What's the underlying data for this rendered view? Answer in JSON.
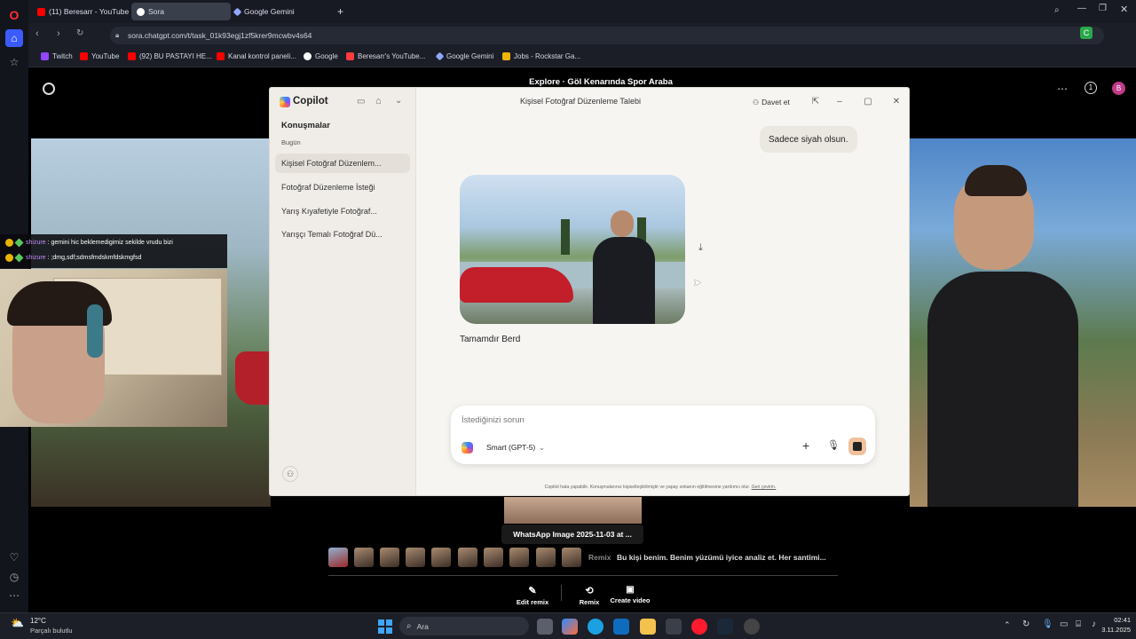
{
  "browser": {
    "tabs": [
      {
        "label": "(11) Beresarr - YouTube",
        "color": "#ff0000"
      },
      {
        "label": "Sora",
        "color": "#ffffff"
      },
      {
        "label": "Google Gemini",
        "color": "#8fa8ff"
      }
    ],
    "url": "sora.chatgpt.com/t/task_01k93egj1zf5krer9mcwbv4s64",
    "bookmarks": [
      {
        "label": "Twitch",
        "color": "#9146ff"
      },
      {
        "label": "YouTube",
        "color": "#ff0000"
      },
      {
        "label": "(92) BU PASTAYI HE...",
        "color": "#ff0000"
      },
      {
        "label": "Kanal kontrol paneli...",
        "color": "#ff0000"
      },
      {
        "label": "Google",
        "color": "#ffffff"
      },
      {
        "label": "Beresarr's YouTube...",
        "color": "#ff3b3b"
      },
      {
        "label": "Google Gemini",
        "color": "#8fa8ff"
      },
      {
        "label": "Jobs - Rockstar Ga...",
        "color": "#f0b400"
      }
    ]
  },
  "sora": {
    "title": "Explore  ·  Göl Kenarında Spor Araba",
    "hover_caption": "WhatsApp Image 2025-11-03 at ...",
    "remix_label": "Remix",
    "prompt_text": "Bu kişi benim. Benim yüzümü iyice analiz et. Her santimi...",
    "actions": [
      {
        "label": "Edit remix"
      },
      {
        "label": "Remix"
      },
      {
        "label": "Create video"
      }
    ],
    "notification_count": "1",
    "avatar_letter": "B"
  },
  "stream_chat": [
    {
      "user": "shizure",
      "text": "gemini hic beklemedigimiz sekilde vrudu bizi"
    },
    {
      "user": "shizure",
      "text": ";dmg,sdf;sdmsfmdskmfdskmgfsd"
    }
  ],
  "copilot": {
    "app_name": "Copilot",
    "section_title": "Konuşmalar",
    "section_sub": "Bugün",
    "conversations": [
      "Kişisel Fotoğraf Düzenlem...",
      "Fotoğraf Düzenleme İsteği",
      "Yarış Kıyafetiyle Fotoğraf...",
      "Yarışçı Temalı Fotoğraf Dü..."
    ],
    "chat_title": "Kişisel Fotoğraf Düzenleme Talebi",
    "invite_label": "Davet et",
    "user_message": "Sadece siyah olsun.",
    "assistant_message": "Tamamdır Berd",
    "composer_placeholder": "İstediğinizi sorun",
    "model_label": "Smart (GPT-5)",
    "disclaimer": "Copilot hata yapabilir. Konuşmalarınız kişiselleştirilmiştir ve yapay zekanın eğitilmesine yardımcı olur.",
    "disclaimer_link": "Geri çevirin."
  },
  "taskbar": {
    "weather_temp": "12°C",
    "weather_desc": "Parçalı bulutlu",
    "search_placeholder": "Ara",
    "time": "02:41",
    "date": "3.11.2025"
  }
}
